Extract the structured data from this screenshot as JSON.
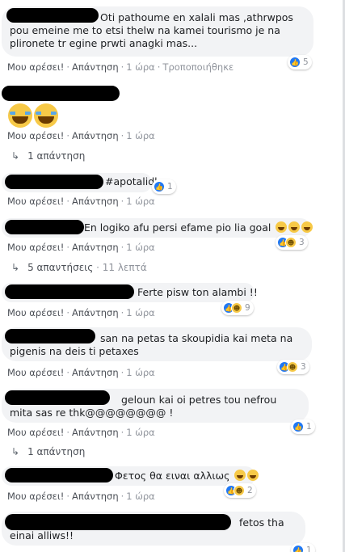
{
  "labels": {
    "like": "Μου αρέσει!",
    "reply": "Απάντηση",
    "sep": "·"
  },
  "comments": [
    {
      "text": "Oti pathoume en xalali mas ,athrwpos pou emeine me to etsi thelw na kamei tourismo je na plironete tr egine prwti anagki mas...",
      "time": "1 ώρα",
      "edited": "Τροποποιήθηκε",
      "reactions": "5"
    },
    {
      "text": "",
      "time": "1 ώρα",
      "replies": "1 απάντηση"
    },
    {
      "text": "#apotalidl",
      "time": "1 ώρα",
      "reactions": "1"
    },
    {
      "text": "En logiko afu persi efame pio lia goal",
      "time": "1 ώρα",
      "reactions": "3",
      "replies": "5 απαντήσεις",
      "reply_time": "11 λεπτά"
    },
    {
      "text": "Ferte pisw ton alambi !!",
      "time": "1 ώρα",
      "reactions": "9"
    },
    {
      "text": "san na petas ta skoupidia kai meta na pigenis na deis ti petaxes",
      "time": "1 ώρα",
      "reactions": "3"
    },
    {
      "text": "geloun kai oi petres tou nefrou mita sas re thk@@@@@@@@ !",
      "time": "1 ώρα",
      "reactions": "1",
      "replies": "1 απάντηση"
    },
    {
      "text": "Φετος θα ειναι αλλιως",
      "time": "1 ώρα",
      "reactions": "2"
    },
    {
      "text": "fetos tha einai alliws!!",
      "reactions": "1"
    }
  ],
  "colors": {
    "bubble": "#f2f3f5",
    "like_blue": "#2078f4",
    "haha_yellow": "#f7c947",
    "meta_gray": "#90949c"
  }
}
